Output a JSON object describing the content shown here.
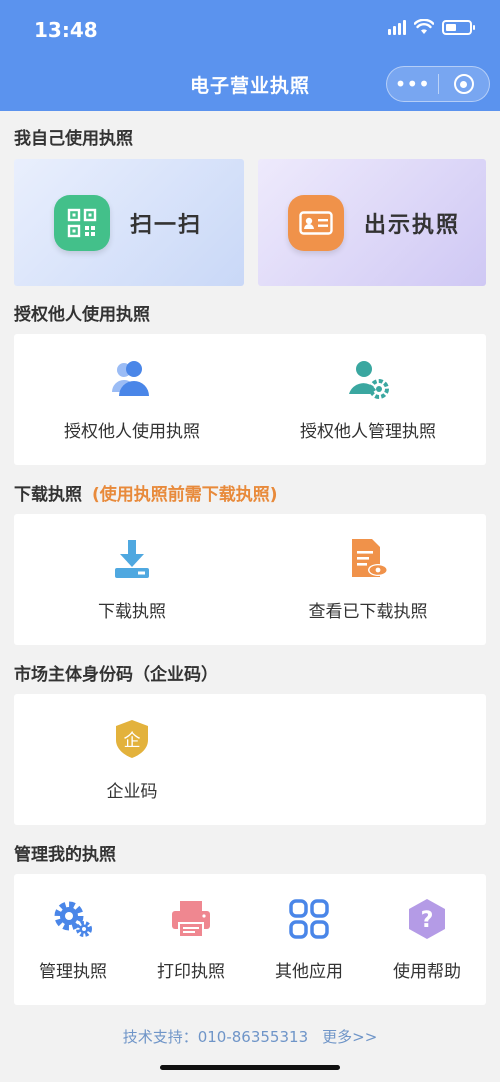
{
  "status_bar": {
    "time": "13:48"
  },
  "nav": {
    "title": "电子营业执照",
    "more_glyph": "•••"
  },
  "sections": {
    "self_use": "我自己使用执照",
    "authorize": "授权他人使用执照",
    "download": "下载执照",
    "download_note": "(使用执照前需下载执照)",
    "entity_code": "市场主体身份码（企业码）",
    "manage": "管理我的执照"
  },
  "self_use": {
    "scan_label": "扫一扫",
    "show_label": "出示执照"
  },
  "authorize": {
    "use_label": "授权他人使用执照",
    "manage_label": "授权他人管理执照"
  },
  "download": {
    "download_label": "下载执照",
    "view_label": "查看已下载执照"
  },
  "entity_code": {
    "code_label": "企业码",
    "badge_char": "企"
  },
  "manage": {
    "items": [
      {
        "label": "管理执照",
        "icon": "gear-icon"
      },
      {
        "label": "打印执照",
        "icon": "printer-icon"
      },
      {
        "label": "其他应用",
        "icon": "apps-grid-icon"
      },
      {
        "label": "使用帮助",
        "icon": "help-icon"
      }
    ]
  },
  "footer": {
    "support": "技术支持：010-86355313",
    "more": "更多>>"
  },
  "colors": {
    "nav_blue": "#5b93ee",
    "icon_blue": "#4a86e8",
    "orange": "#f0924a",
    "scan_green": "#43c08a",
    "teal": "#3aa7a0",
    "gold": "#e3b23c",
    "pink": "#ef8790",
    "purple": "#b49be6",
    "note_orange": "#e88a3b",
    "link_blue": "#6f95c8"
  }
}
